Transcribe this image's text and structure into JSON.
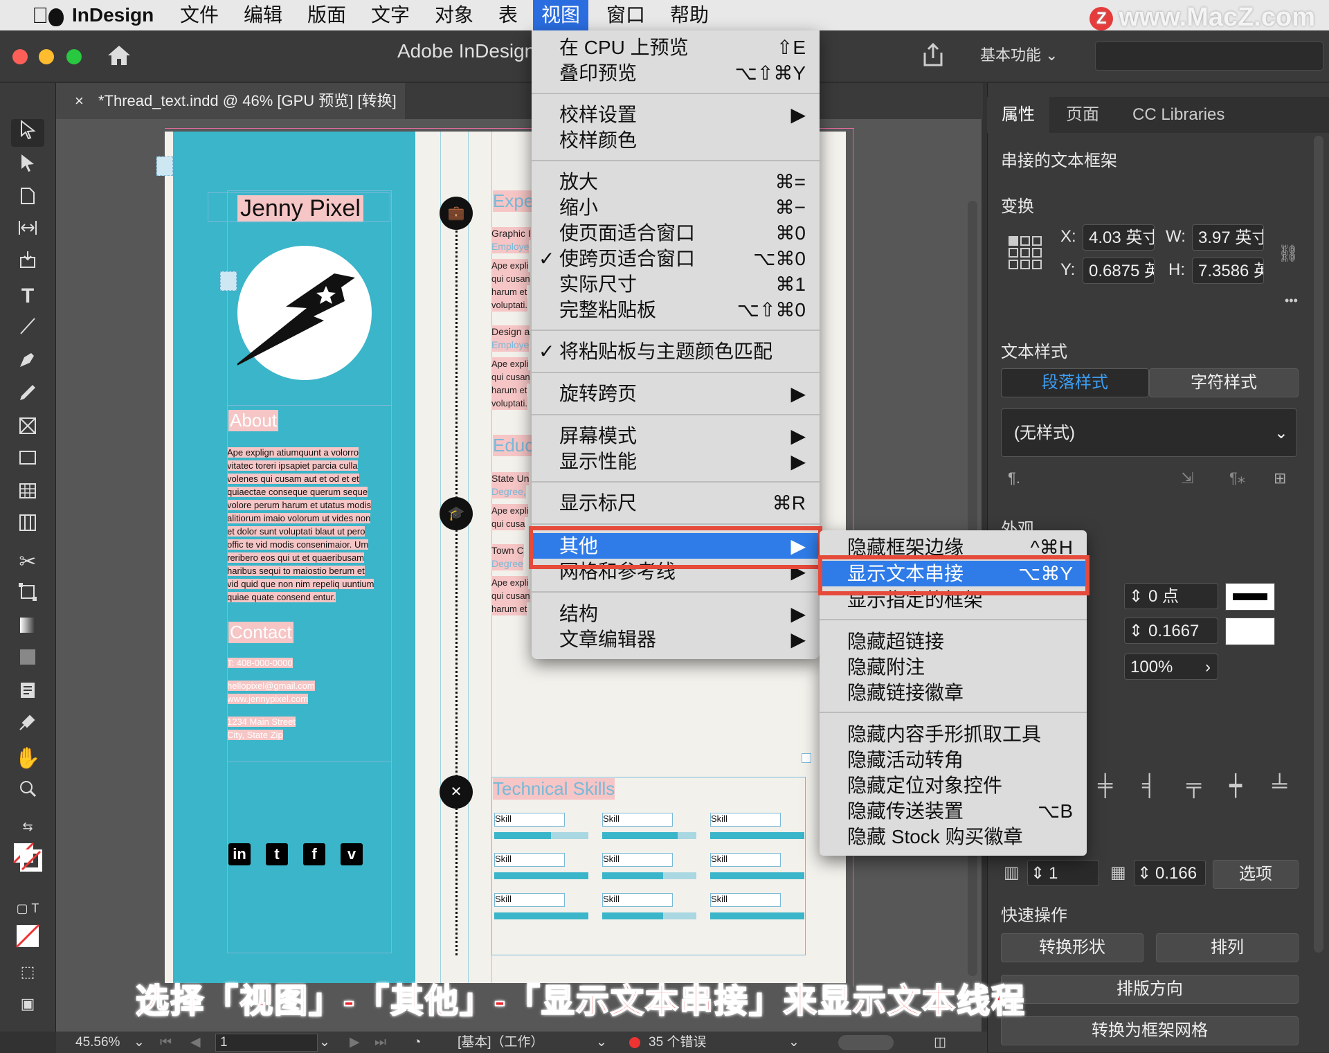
{
  "menubar": {
    "apple": "",
    "app_name": "InDesign",
    "items": [
      "文件",
      "编辑",
      "版面",
      "文字",
      "对象",
      "表",
      "视图",
      "窗口",
      "帮助"
    ],
    "active_item": "视图",
    "watermark": "www.MacZ.com",
    "watermark_badge": "Z"
  },
  "titlebar": {
    "app_title": "Adobe InDesign",
    "workspace": "基本功能"
  },
  "document": {
    "tab_title": "*Thread_text.indd @ 46% [GPU 预览] [转换]",
    "close": "×"
  },
  "resume": {
    "name": "Jenny Pixel",
    "about_head": "About",
    "about_lines": [
      "Ape explign atiumquunt a volorro",
      "vitatec toreri ipsapiet parcia culla",
      "volenes qui cusam aut et od et et",
      "quiaectae conseque querum seque",
      "volore perum harum et utatus modis",
      "alitiorum imaio volorum ut vides non",
      "et dolor sunt voluptati blaut ut pero",
      "offic te vid modis consenimaior. Um",
      "reribero eos qui ut et quaeribusam",
      "haribus sequi to maiostio berum et",
      "vid quid que non nim repeliq uuntium",
      "quiae quate consend entur."
    ],
    "contact_head": "Contact",
    "contact_lines": [
      "T: 408-000-0000",
      "hellopixel@gmail.com",
      "www.jennypixel.com",
      "1234 Main Street",
      "City, State Zip"
    ],
    "social": [
      "in",
      "t",
      "f",
      "v"
    ],
    "experience_head": "Expe",
    "education_head": "Educ",
    "tech_head": "Technical Skills",
    "mid_blocks": [
      {
        "title": "Graphic I",
        "sub": "Employe",
        "lines": [
          "Ape expli",
          "qui cusan",
          "harum et",
          "voluptati."
        ]
      },
      {
        "title": "Design a",
        "sub": "Employe",
        "lines": [
          "Ape expli",
          "qui cusan",
          "harum et",
          "voluptati."
        ]
      },
      {
        "title": "State Un",
        "sub": "Degree,",
        "lines": [
          "Ape expli",
          "qui cusa"
        ]
      },
      {
        "title": "Town C",
        "sub": "Degree",
        "lines": [
          "Ape expli",
          "qui cusan",
          "harum et"
        ]
      }
    ],
    "skills": [
      {
        "label": "Skill",
        "level": 0.6
      },
      {
        "label": "Skill",
        "level": 0.8
      },
      {
        "label": "Skill",
        "level": 1.0
      },
      {
        "label": "Skill",
        "level": 1.0
      },
      {
        "label": "Skill",
        "level": 0.65
      },
      {
        "label": "Skill",
        "level": 1.0
      },
      {
        "label": "Skill",
        "level": 1.0
      },
      {
        "label": "Skill",
        "level": 0.65
      },
      {
        "label": "Skill",
        "level": 1.0
      }
    ]
  },
  "view_menu": {
    "items": [
      {
        "label": "在 CPU 上预览",
        "key": "⇧E"
      },
      {
        "label": "叠印预览",
        "key": "⌥⇧⌘Y"
      },
      {
        "label": "校样设置",
        "key": "▶"
      },
      {
        "label": "校样颜色",
        "key": ""
      },
      {
        "label": "放大",
        "key": "⌘="
      },
      {
        "label": "缩小",
        "key": "⌘−"
      },
      {
        "label": "使页面适合窗口",
        "key": "⌘0"
      },
      {
        "label": "使跨页适合窗口",
        "key": "⌥⌘0",
        "checked": "✓"
      },
      {
        "label": "实际尺寸",
        "key": "⌘1"
      },
      {
        "label": "完整粘贴板",
        "key": "⌥⇧⌘0"
      },
      {
        "label": "将粘贴板与主题颜色匹配",
        "key": "",
        "checked": "✓"
      },
      {
        "label": "旋转跨页",
        "key": "▶"
      },
      {
        "label": "屏幕模式",
        "key": "▶"
      },
      {
        "label": "显示性能",
        "key": "▶"
      },
      {
        "label": "显示标尺",
        "key": "⌘R"
      },
      {
        "label": "其他",
        "key": "▶"
      },
      {
        "label": "网格和参考线",
        "key": "▶"
      },
      {
        "label": "结构",
        "key": "▶"
      },
      {
        "label": "文章编辑器",
        "key": "▶"
      }
    ]
  },
  "other_menu": {
    "items": [
      {
        "label": "隐藏框架边缘",
        "key": "^⌘H"
      },
      {
        "label": "显示文本串接",
        "key": "⌥⌘Y"
      },
      {
        "label": "显示指定的框架",
        "key": ""
      },
      {
        "label": "隐藏超链接",
        "key": ""
      },
      {
        "label": "隐藏附注",
        "key": ""
      },
      {
        "label": "隐藏链接徽章",
        "key": ""
      },
      {
        "label": "隐藏内容手形抓取工具",
        "key": ""
      },
      {
        "label": "隐藏活动转角",
        "key": ""
      },
      {
        "label": "隐藏定位对象控件",
        "key": ""
      },
      {
        "label": "隐藏传送装置",
        "key": "⌥B"
      },
      {
        "label": "隐藏 Stock 购买徽章",
        "key": ""
      }
    ]
  },
  "panel": {
    "tabs": [
      "属性",
      "页面",
      "CC Libraries"
    ],
    "section_title": "串接的文本框架",
    "transform_head": "变换",
    "x_label": "X:",
    "x_value": "4.03 英寸",
    "w_label": "W:",
    "w_value": "3.97 英寸",
    "y_label": "Y:",
    "y_value": "0.6875 英",
    "h_label": "H:",
    "h_value": "7.3586 英",
    "more": "•••",
    "text_style_head": "文本样式",
    "para_style": "段落样式",
    "char_style": "字符样式",
    "style_value": "(无样式)",
    "appearance_head": "外观",
    "stroke_value": "0 点",
    "fill_value": "0.1667",
    "opacity_value": "100%",
    "cols_value": "1",
    "gutter_value": "0.166",
    "options": "选项",
    "quick_head": "快速操作",
    "btn_convert_shape": "转换形状",
    "btn_arrange": "排列",
    "btn_orientation": "排版方向",
    "btn_grid": "转换为框架网格"
  },
  "status": {
    "zoom": "45.56%",
    "page": "1",
    "master": "[基本]（工作）",
    "errors": "35 个错误"
  },
  "caption": "选择「视图」-「其他」-「显示文本串接」来显示文本线程",
  "colors": {
    "accent": "#2f7ce8",
    "highlight_box": "#e64a3a",
    "resume_teal": "#3ab5c9",
    "resume_pink": "#f6c5c5"
  }
}
